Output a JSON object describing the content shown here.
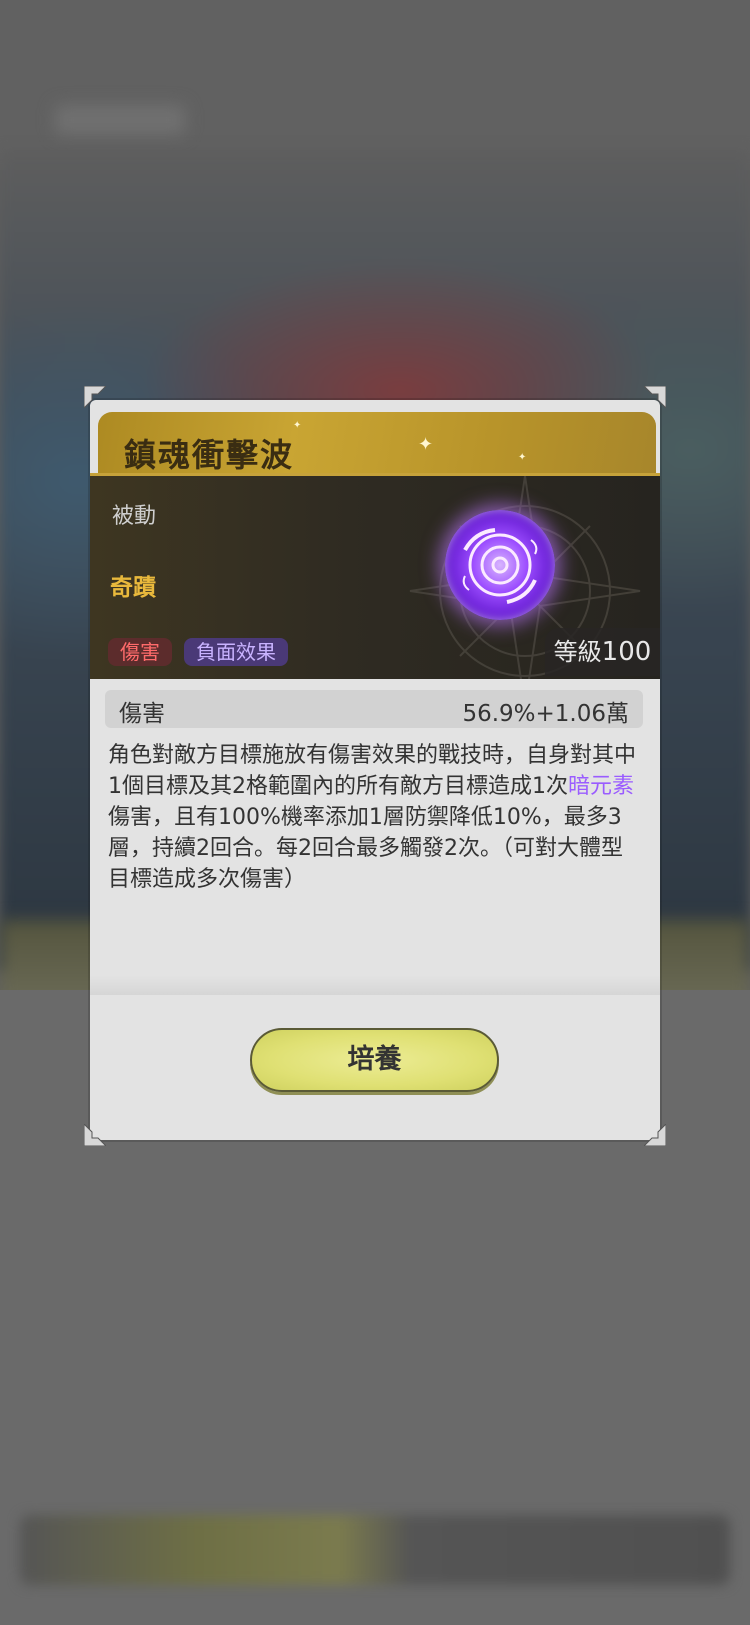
{
  "skill": {
    "name": "鎮魂衝擊波",
    "type": "被動",
    "rarity": "奇蹟",
    "tags": [
      "傷害",
      "負面效果"
    ],
    "level_label": "等級",
    "level": "100",
    "icon": "dark-element-skill-orb-icon"
  },
  "stat": {
    "label": "傷害",
    "value": "56.9%+1.06萬"
  },
  "description": {
    "part1": "角色對敵方目標施放有傷害效果的戰技時，自身對其中1個目標及其2格範圍內的所有敵方目標造成1次",
    "element": "暗元素",
    "part2": "傷害，且有100%機率添加1層防禦降低10%，最多3層，持續2回合。每2回合最多觸發2次。（可對大體型目標造成多次傷害）"
  },
  "actions": {
    "foster_label": "培養"
  },
  "colors": {
    "title_gold": "#c9a533",
    "rarity": "#e9b93c",
    "element_purple": "#9a5cff",
    "button_yellow": "#dfe073"
  }
}
